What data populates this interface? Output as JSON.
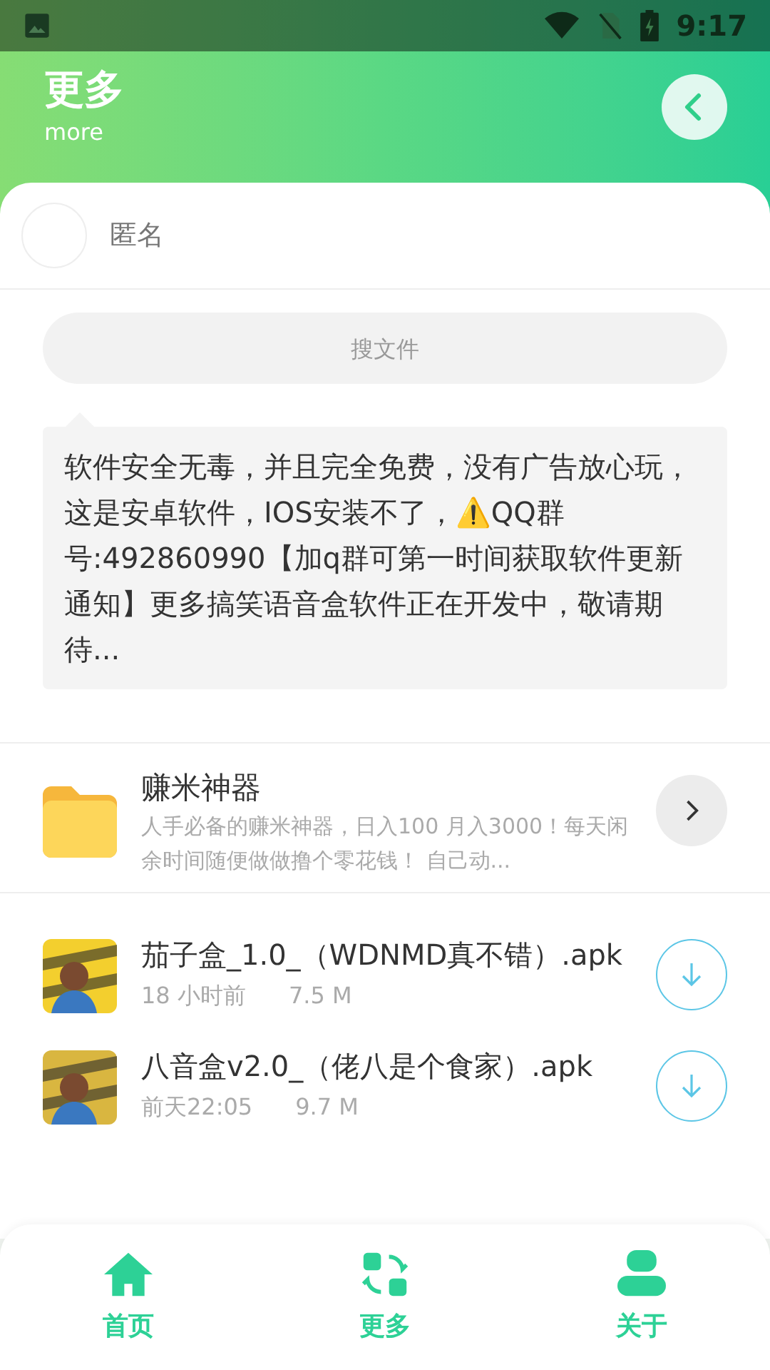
{
  "status_bar": {
    "time": "9:17"
  },
  "header": {
    "title": "更多",
    "subtitle": "more"
  },
  "user": {
    "name": "匿名"
  },
  "search": {
    "placeholder": "搜文件"
  },
  "notice": {
    "text": "软件安全无毒，并且完全免费，没有广告放心玩，这是安卓软件，IOS安装不了，⚠️QQ群号:492860990【加q群可第一时间获取软件更新通知】更多搞笑语音盒软件正在开发中，敬请期待..."
  },
  "files": [
    {
      "kind": "folder",
      "title": "赚米神器",
      "description": "人手必备的赚米神器，日入100 月入3000！每天闲余时间随便做做撸个零花钱！ 自己动..."
    },
    {
      "kind": "apk",
      "title": "茄子盒_1.0_（WDNMD真不错）.apk",
      "time": "18 小时前",
      "size": "7.5 M"
    },
    {
      "kind": "apk",
      "title": "八音盒v2.0_（佬八是个食家）.apk",
      "time": "前天22:05",
      "size": "9.7 M"
    }
  ],
  "nav": [
    {
      "label": "首页",
      "kind": "home"
    },
    {
      "label": "更多",
      "kind": "more"
    },
    {
      "label": "关于",
      "kind": "about"
    }
  ]
}
